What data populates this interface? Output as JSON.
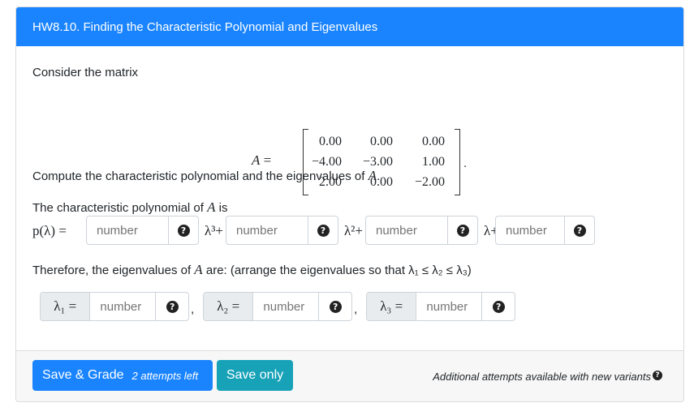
{
  "header": {
    "title": "HW8.10. Finding the Characteristic Polynomial and Eigenvalues"
  },
  "body": {
    "intro": "Consider the matrix",
    "matrix_name": "A =",
    "matrix_trailing": ".",
    "matrix": [
      [
        "0.00",
        "0.00",
        "0.00"
      ],
      [
        "−4.00",
        "−3.00",
        "1.00"
      ],
      [
        "2.00",
        "0.00",
        "−2.00"
      ]
    ],
    "prompt_pre": "Compute the characteristic polynomial and the eigenvalues of ",
    "prompt_var": "A",
    "prompt_post": ".",
    "poly_label_pre": "The characteristic polynomial of ",
    "poly_label_var": "A",
    "poly_label_post": " is",
    "poly_lhs": "p(λ) =",
    "poly_terms": [
      "λ³+",
      "λ²+",
      "λ+"
    ],
    "input_placeholder": "number",
    "eig_text_pre": "Therefore, the eigenvalues of ",
    "eig_text_var": "A",
    "eig_text_post": " are: (arrange the eigenvalues so that λ₁ ≤ λ₂ ≤ λ₃)",
    "eig_labels": [
      "λ₁ =",
      "λ₂ =",
      "λ₃ ="
    ],
    "separator": ","
  },
  "footer": {
    "grade_label": "Save & Grade",
    "attempts": "2 attempts left",
    "save_label": "Save only",
    "note": "Additional attempts available with new variants"
  },
  "colors": {
    "primary": "#1a84ff",
    "info": "#17a2b8",
    "footer_bg": "#f7f7f7"
  },
  "icons": {
    "help": "question-circle-icon"
  }
}
